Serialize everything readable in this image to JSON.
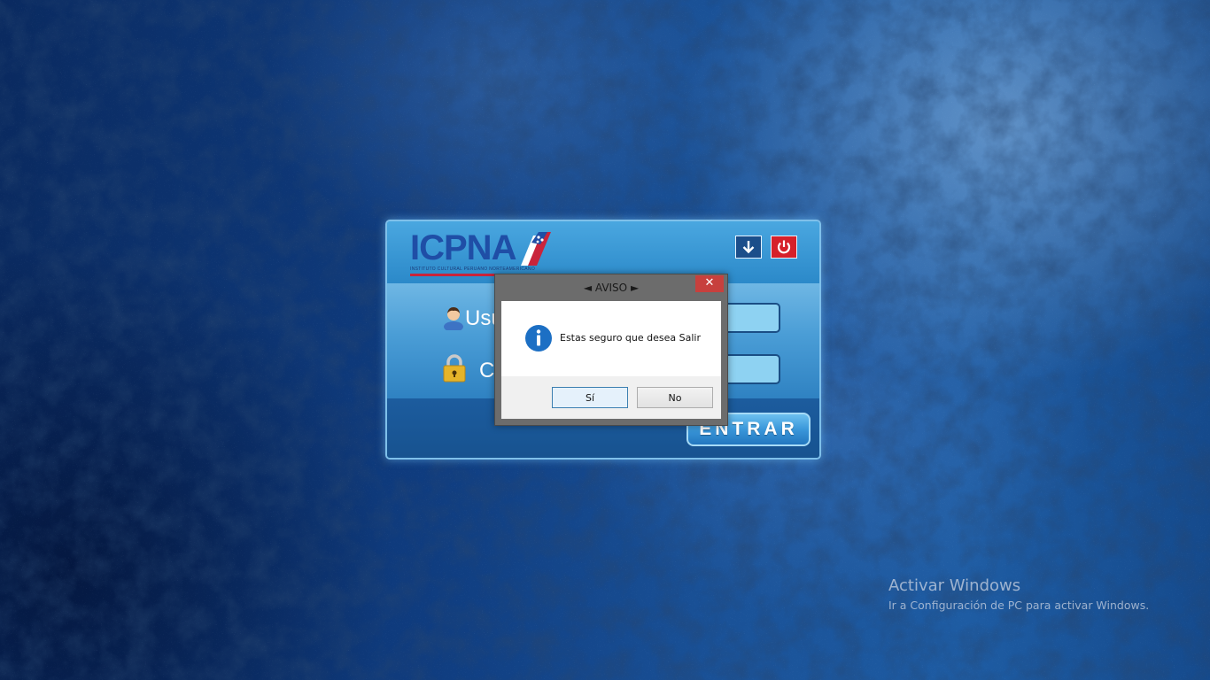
{
  "desktop": {
    "watermark": {
      "title": "Activar Windows",
      "subtitle": "Ir a Configuración de PC para activar Windows."
    }
  },
  "login": {
    "logo": {
      "text": "ICPNA",
      "tagline": "INSTITUTO CULTURAL PERUANO NORTEAMERICANO"
    },
    "minimize_icon": "arrow-down-icon",
    "close_icon": "power-icon",
    "username_label": "Usu",
    "password_label": "C",
    "submit_label": "ENTRAR",
    "colors": {
      "panel": "#2a85c6",
      "input": "#8ed2f2",
      "close_button": "#d6202a"
    }
  },
  "dialog": {
    "title": "◄ AVISO ►",
    "close_label": "✕",
    "icon": "info-icon",
    "message": "Estas seguro que desea Salir",
    "yes_label": "Sí",
    "no_label": "No"
  }
}
